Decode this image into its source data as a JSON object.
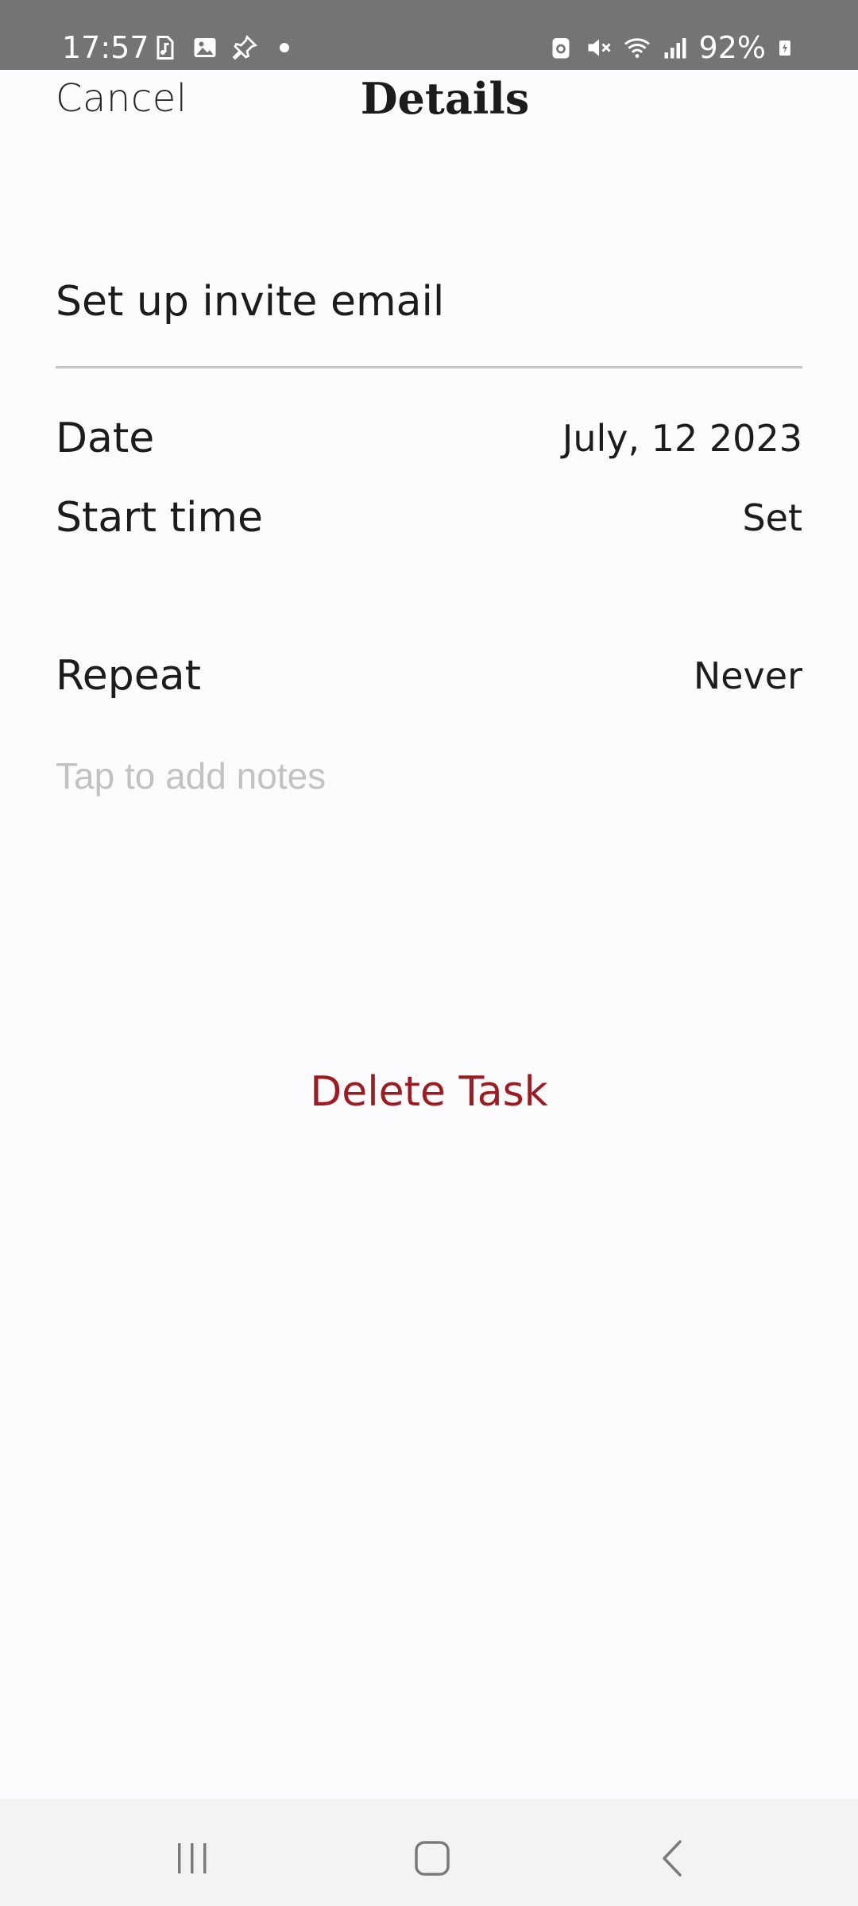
{
  "status_bar": {
    "time": "17:57",
    "battery": "92%",
    "left_icons": [
      "music-file-icon",
      "image-icon",
      "pin-icon",
      "dot-icon"
    ],
    "right_icons": [
      "battery-saver-icon",
      "mute-icon",
      "wifi-icon",
      "signal-icon",
      "battery-charging-icon"
    ]
  },
  "header": {
    "cancel_label": "Cancel",
    "title": "Details"
  },
  "task": {
    "title": "Set up invite email"
  },
  "fields": {
    "date_label": "Date",
    "date_value": "July, 12 2023",
    "start_time_label": "Start time",
    "start_time_value": "Set",
    "repeat_label": "Repeat",
    "repeat_value": "Never"
  },
  "notes": {
    "placeholder": "Tap to add notes"
  },
  "actions": {
    "delete_label": "Delete Task"
  },
  "colors": {
    "accent_delete": "#9e1b22",
    "status_bar": "#747474",
    "background": "#fcfcfe"
  }
}
